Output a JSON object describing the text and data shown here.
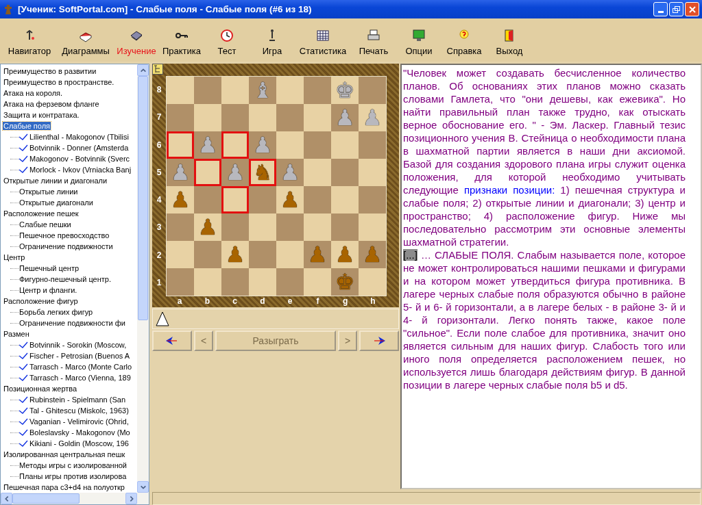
{
  "window": {
    "title": "[Ученик: SoftPortal.com]  - Слабые поля - Слабые поля (#6 из 18)"
  },
  "toolbar": [
    {
      "kind": "navigator",
      "label": "Навигатор",
      "selected": false
    },
    {
      "kind": "diagrams",
      "label": "Диаграммы",
      "selected": false
    },
    {
      "kind": "study",
      "label": "Изучение",
      "selected": true
    },
    {
      "kind": "practice",
      "label": "Практика",
      "selected": false
    },
    {
      "kind": "test",
      "label": "Тест",
      "selected": false
    },
    {
      "kind": "game",
      "label": "Игра",
      "selected": false
    },
    {
      "kind": "stats",
      "label": "Статистика",
      "selected": false
    },
    {
      "kind": "print",
      "label": "Печать",
      "selected": false
    },
    {
      "kind": "options",
      "label": "Опции",
      "selected": false
    },
    {
      "kind": "help",
      "label": "Справка",
      "selected": false
    },
    {
      "kind": "exit",
      "label": "Выход",
      "selected": false
    }
  ],
  "tree": {
    "items": [
      {
        "kind": "topic",
        "label": "Преимущество в развитии",
        "selected": false
      },
      {
        "kind": "topic",
        "label": "Преимущество в пространстве.",
        "selected": false
      },
      {
        "kind": "topic",
        "label": "Атака на короля.",
        "selected": false
      },
      {
        "kind": "topic",
        "label": "Атака на ферзевом фланге",
        "selected": false
      },
      {
        "kind": "topic",
        "label": "Защита и контратака.",
        "selected": false
      },
      {
        "kind": "topic",
        "label": "Слабые поля",
        "selected": true,
        "children": [
          {
            "kind": "game",
            "label": "Lilienthal - Makogonov (Tbilisi",
            "selected": false
          },
          {
            "kind": "game",
            "label": "Botvinnik - Donner (Amsterda",
            "selected": false
          },
          {
            "kind": "game",
            "label": "Makogonov - Botvinnik (Sverc",
            "selected": false
          },
          {
            "kind": "game",
            "label": "Morlock - Ivkov (Vrniacka Banj",
            "selected": false
          }
        ]
      },
      {
        "kind": "topic",
        "label": "Открытые линии и диагонали",
        "selected": false,
        "children": [
          {
            "kind": "topic",
            "label": "Открытые линии",
            "selected": false
          },
          {
            "kind": "topic",
            "label": "Открытые диагонали",
            "selected": false
          }
        ]
      },
      {
        "kind": "topic",
        "label": "Расположение пешек",
        "selected": false,
        "children": [
          {
            "kind": "topic",
            "label": "Слабые пешки",
            "selected": false
          },
          {
            "kind": "topic",
            "label": "Пешечное превосходство",
            "selected": false
          },
          {
            "kind": "topic",
            "label": "Ограничение подвижности",
            "selected": false
          }
        ]
      },
      {
        "kind": "topic",
        "label": "Центр",
        "selected": false,
        "children": [
          {
            "kind": "topic",
            "label": "Пешечный центр",
            "selected": false
          },
          {
            "kind": "topic",
            "label": "Фигурно-пешечный центр.",
            "selected": false
          },
          {
            "kind": "topic",
            "label": "Центр и фланги.",
            "selected": false
          }
        ]
      },
      {
        "kind": "topic",
        "label": "Расположение фигур",
        "selected": false,
        "children": [
          {
            "kind": "topic",
            "label": "Борьба легких фигур",
            "selected": false
          },
          {
            "kind": "topic",
            "label": "Ограничение подвижности фи",
            "selected": false
          }
        ]
      },
      {
        "kind": "topic",
        "label": "Размен",
        "selected": false,
        "children": [
          {
            "kind": "game",
            "label": "Botvinnik - Sorokin (Moscow,",
            "selected": false
          },
          {
            "kind": "game",
            "label": "Fischer - Petrosian (Buenos A",
            "selected": false
          },
          {
            "kind": "game",
            "label": "Tarrasch - Marco (Monte Carlo",
            "selected": false
          },
          {
            "kind": "game",
            "label": "Tarrasch - Marco (Vienna, 189",
            "selected": false
          }
        ]
      },
      {
        "kind": "topic",
        "label": "Позиционная жертва",
        "selected": false,
        "children": [
          {
            "kind": "game",
            "label": "Rubinstein - Spielmann (San",
            "selected": false
          },
          {
            "kind": "game",
            "label": "Tal - Ghitescu (Miskolc, 1963)",
            "selected": false
          },
          {
            "kind": "game",
            "label": "Vaganian - Velimirovic (Ohrid,",
            "selected": false
          },
          {
            "kind": "game",
            "label": "Boleslavsky - Makogonov (Mo",
            "selected": false
          },
          {
            "kind": "game",
            "label": "Kikiani - Goldin (Moscow, 196",
            "selected": false
          }
        ]
      },
      {
        "kind": "topic",
        "label": "Изолированная центральная пешк",
        "selected": false,
        "children": [
          {
            "kind": "topic",
            "label": "Методы игры с изолированной",
            "selected": false
          },
          {
            "kind": "topic",
            "label": "Планы игры против изолирова",
            "selected": false
          }
        ]
      },
      {
        "kind": "topic",
        "label": "Пешечная пара c3+d4 на полуоткр",
        "selected": false
      }
    ]
  },
  "board": {
    "files": [
      "a",
      "b",
      "c",
      "d",
      "e",
      "f",
      "g",
      "h"
    ],
    "ranks": [
      {
        "label": "8",
        "squares": [
          {
            "highlighted": false
          },
          {
            "highlighted": false
          },
          {
            "highlighted": false
          },
          {
            "highlighted": false,
            "piece": {
              "glyph": "♝",
              "kind": "black"
            }
          },
          {
            "highlighted": false
          },
          {
            "highlighted": false
          },
          {
            "highlighted": false,
            "piece": {
              "glyph": "♚",
              "kind": "black"
            }
          },
          {
            "highlighted": false
          }
        ]
      },
      {
        "label": "7",
        "squares": [
          {
            "highlighted": false
          },
          {
            "highlighted": false
          },
          {
            "highlighted": false
          },
          {
            "highlighted": false
          },
          {
            "highlighted": false
          },
          {
            "highlighted": false
          },
          {
            "highlighted": false,
            "piece": {
              "glyph": "♟",
              "kind": "black"
            }
          },
          {
            "highlighted": false,
            "piece": {
              "glyph": "♟",
              "kind": "black"
            }
          }
        ]
      },
      {
        "label": "6",
        "squares": [
          {
            "highlighted": true
          },
          {
            "highlighted": false,
            "piece": {
              "glyph": "♟",
              "kind": "black"
            }
          },
          {
            "highlighted": true
          },
          {
            "highlighted": false,
            "piece": {
              "glyph": "♟",
              "kind": "black"
            }
          },
          {
            "highlighted": false
          },
          {
            "highlighted": false
          },
          {
            "highlighted": false
          },
          {
            "highlighted": false
          }
        ]
      },
      {
        "label": "5",
        "squares": [
          {
            "highlighted": false,
            "piece": {
              "glyph": "♟",
              "kind": "black"
            }
          },
          {
            "highlighted": true
          },
          {
            "highlighted": false,
            "piece": {
              "glyph": "♟",
              "kind": "black"
            }
          },
          {
            "highlighted": true,
            "piece": {
              "glyph": "♞",
              "kind": "white"
            }
          },
          {
            "highlighted": false,
            "piece": {
              "glyph": "♟",
              "kind": "black"
            }
          },
          {
            "highlighted": false
          },
          {
            "highlighted": false
          },
          {
            "highlighted": false
          }
        ]
      },
      {
        "label": "4",
        "squares": [
          {
            "highlighted": false,
            "piece": {
              "glyph": "♟",
              "kind": "white"
            }
          },
          {
            "highlighted": false
          },
          {
            "highlighted": true
          },
          {
            "highlighted": false
          },
          {
            "highlighted": false,
            "piece": {
              "glyph": "♟",
              "kind": "white"
            }
          },
          {
            "highlighted": false
          },
          {
            "highlighted": false
          },
          {
            "highlighted": false
          }
        ]
      },
      {
        "label": "3",
        "squares": [
          {
            "highlighted": false
          },
          {
            "highlighted": false,
            "piece": {
              "glyph": "♟",
              "kind": "white"
            }
          },
          {
            "highlighted": false
          },
          {
            "highlighted": false
          },
          {
            "highlighted": false
          },
          {
            "highlighted": false
          },
          {
            "highlighted": false
          },
          {
            "highlighted": false
          }
        ]
      },
      {
        "label": "2",
        "squares": [
          {
            "highlighted": false
          },
          {
            "highlighted": false
          },
          {
            "highlighted": false,
            "piece": {
              "glyph": "♟",
              "kind": "white"
            }
          },
          {
            "highlighted": false
          },
          {
            "highlighted": false
          },
          {
            "highlighted": false,
            "piece": {
              "glyph": "♟",
              "kind": "white"
            }
          },
          {
            "highlighted": false,
            "piece": {
              "glyph": "♟",
              "kind": "white"
            }
          },
          {
            "highlighted": false,
            "piece": {
              "glyph": "♟",
              "kind": "white"
            }
          }
        ]
      },
      {
        "label": "1",
        "squares": [
          {
            "highlighted": false
          },
          {
            "highlighted": false
          },
          {
            "highlighted": false
          },
          {
            "highlighted": false
          },
          {
            "highlighted": false
          },
          {
            "highlighted": false
          },
          {
            "highlighted": false,
            "piece": {
              "glyph": "♚",
              "kind": "white"
            }
          },
          {
            "highlighted": false
          }
        ]
      }
    ],
    "white_to_move": true,
    "buttons": [
      {
        "kind": "first",
        "disabled": false
      },
      {
        "kind": "prev",
        "label": "<",
        "disabled": true
      },
      {
        "kind": "play",
        "label": "Разыграть",
        "disabled": true
      },
      {
        "kind": "next",
        "label": ">",
        "disabled": true
      },
      {
        "kind": "last",
        "disabled": false
      }
    ]
  },
  "text": {
    "paragraphs": [
      {
        "kind": "quote",
        "before": "\"Человек может создавать бесчисленное количество планов. Об основаниях этих планов можно сказать словами Гамлета, что \"они дешевы, как ежевика\".  Но найти правильный план также трудно, как  отыскать верное обоснование его. \" - Эм. Ласкер.  Главный тезис позиционного учения В. Стейница о необходимости плана в шахматной партии является в наши дни аксиомой. Базой для создания  здорового плана игры служит оценка положения, для которой необходимо учитывать следующие ",
        "link": "признаки позиции:",
        "after": " 1) пешечная структура и слабые поля; 2) открытые линии и диагонали; 3) центр и пространство;  4) расположение фигур. Ниже мы  последовательно рассмотрим эти основные элементы шахматной стратегии."
      },
      {
        "kind": "section",
        "marker": "[...]",
        "text": " … СЛАБЫЕ ПОЛЯ. Слабым называется  поле, которое не может контролироваться нашими пешками и фигурами и на котором может утвердиться  фигура противника. В лагере черных слабые поля  образуются обычно в районе 5- й и 6- й горизонтали, а в  лагере белых - в районе 3- й и 4- й горизонтали. Легко  понять также, какое поле \"сильное\". Если поле слабое  для противника, значит оно является сильным для наших фигур. Слабость того или иного поля  определяется расположением пешек, но используется лишь благодаря действиям фигур. В данной позиции в лагере черных слабые поля b5 и d5."
      }
    ]
  }
}
